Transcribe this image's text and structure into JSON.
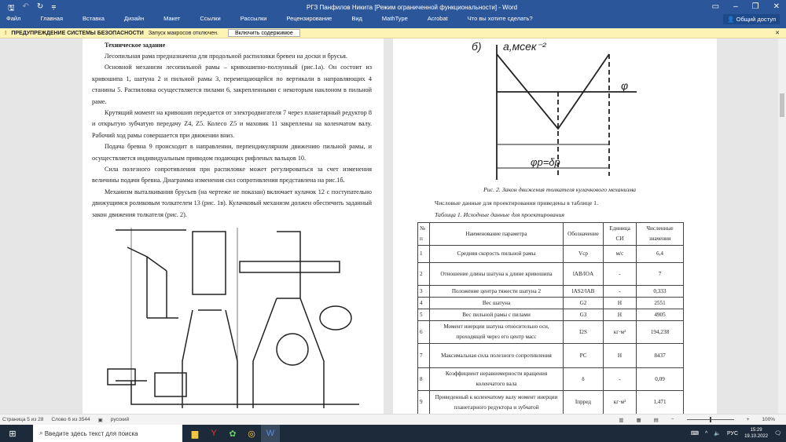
{
  "window": {
    "title": "РГЗ Панфилов Никита [Режим ограниченной функциональности] - Word",
    "share_label": "Общий доступ"
  },
  "ribbon": {
    "tabs": [
      "Файл",
      "Главная",
      "Вставка",
      "Дизайн",
      "Макет",
      "Ссылки",
      "Рассылки",
      "Рецензирование",
      "Вид",
      "MathType",
      "Acrobat"
    ],
    "tell_me": "Что вы хотите сделать?"
  },
  "security": {
    "title": "ПРЕДУПРЕЖДЕНИЕ СИСТЕМЫ БЕЗОПАСНОСТИ",
    "message": "Запуск макросов отключен.",
    "button": "Включить содержимое"
  },
  "page1": {
    "heading": "Техническое задание",
    "paragraphs": [
      "Лесопильная рама предназначена для продольной распиловки бревен на доски и брусья.",
      "Основной механизм лесопильной рамы – кривошипно-ползунный (рис.1а). Он состоит из кривошипа 1, шатуна 2 и пильной рамы 3, перемещающейся по вертикали в направляющих 4 станины 5. Распиловка осуществляется пилами 6, закрепленными с некоторым наклоном в пильной раме.",
      "Крутящий момент на кривошип передается от электродвигателя 7 через планетарный редуктор 8 и открытую зубчатую передачу Z4, Z5. Колесо Z5 и маховик 11 закреплены на коленчатом валу. Рабочий ход рамы совершается при движении вниз.",
      "Подача бревна 9 происходит в направлении, перпендикулярном движению пильной рамы, и осуществляется индивидуальным приводом подающих рифленых вальцов 10.",
      "Сила полезного сопротивления при распиловке может регулироваться за счет изменения величины подачи бревна. Диаграмма изменения сил сопротивления представлена на рис.1б.",
      "Механизм выталкивания брусьев (на чертеже не показан) включает кулачок 12 с поступательно движущимся роликовым толкателем 13 (рис. 1в). Кулачковый механизм должен обеспечить заданный закон движения толкателя (рис. 2)."
    ]
  },
  "page2": {
    "fig_caption": "Рис. 2. Закон движения толкателя кулачкового механизма",
    "intro": "Числовые данные для проектирования приведены в таблице 1.",
    "table_caption": "Таблица 1. Исходные данные для проектирования",
    "table": {
      "headers": [
        "№ п",
        "Наименование параметра",
        "Обозначение",
        "Единица СИ",
        "Численные значения"
      ],
      "rows": [
        [
          "1",
          "Средняя скорость пильной рамы",
          "Vср",
          "м/с",
          "6,4"
        ],
        [
          "2",
          "Отношение длины шатуна к длине кривошипа",
          "lAB/lOA",
          "-",
          "7"
        ],
        [
          "3",
          "Положение центра тяжести шатуна 2",
          "lAS2/lAB",
          "-",
          "0,333"
        ],
        [
          "4",
          "Вес шатуна",
          "G2",
          "Н",
          "2551"
        ],
        [
          "5",
          "Вес пильной рамы с пилами",
          "G3",
          "Н",
          "4905"
        ],
        [
          "6",
          "Момент инерции шатуна относительно оси, проходящей через его центр масс",
          "I2S",
          "кг·м²",
          "194,238"
        ],
        [
          "7",
          "Максимальная сила полезного сопротивления",
          "PC",
          "Н",
          "8437"
        ],
        [
          "8",
          "Коэффициент неравномерности вращения коленчатого вала",
          "δ",
          "-",
          "0,09"
        ],
        [
          "9",
          "Приведенный к коленчатому валу момент инерции планетарного редуктора и зубчатой",
          "Iпрред",
          "кг·м²",
          "1,471"
        ]
      ]
    }
  },
  "status": {
    "page": "Страница 5 из 28",
    "words": "Слово 6 из 3544",
    "lang": "русский",
    "zoom": "100%"
  },
  "taskbar": {
    "search_placeholder": "Введите здесь текст для поиска",
    "lang": "РУС",
    "time": "15:29",
    "date": "19.10.2022"
  }
}
